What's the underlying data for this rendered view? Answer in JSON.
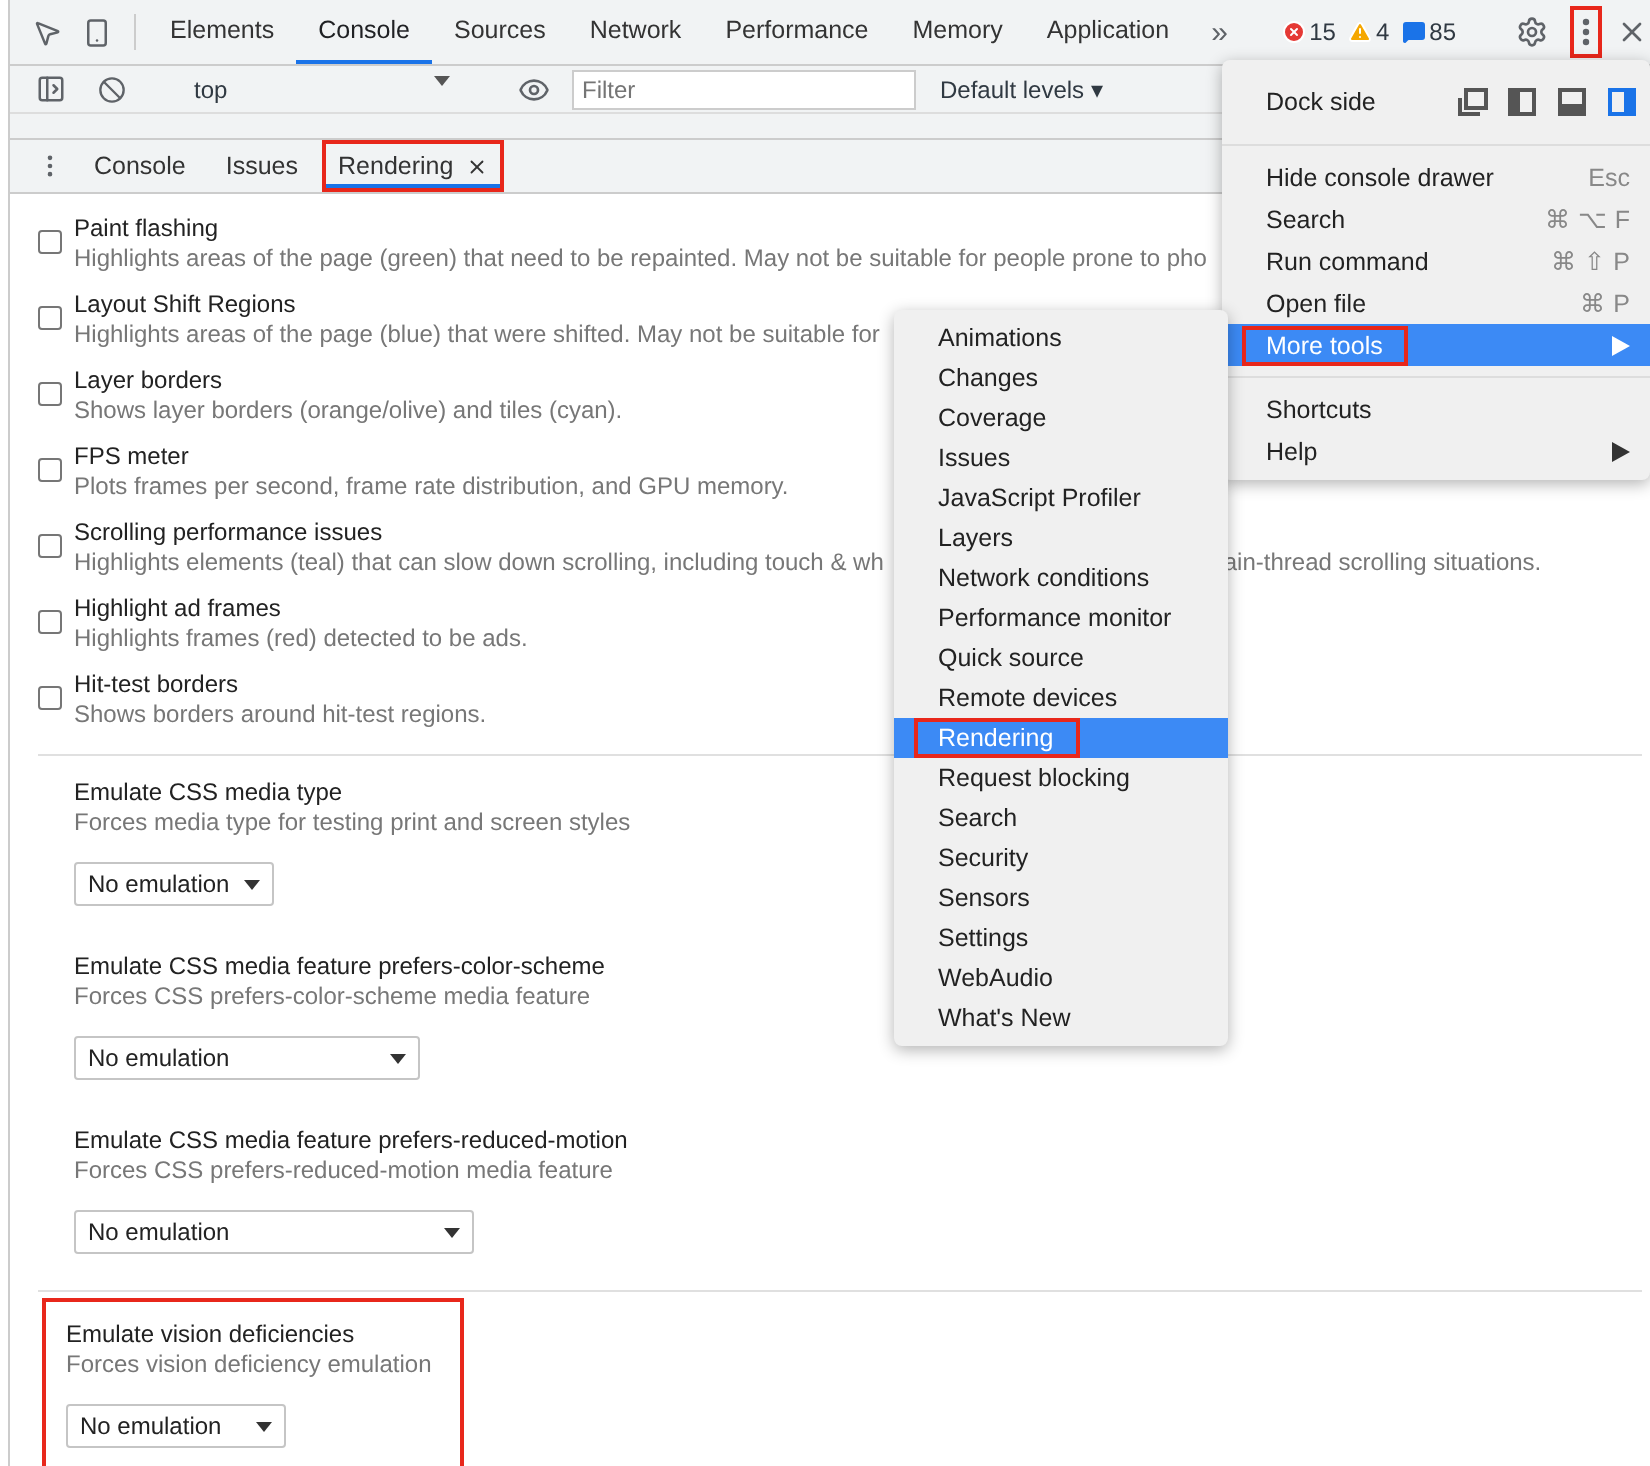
{
  "toolbar": {
    "tabs": [
      {
        "label": "Elements",
        "selected": false
      },
      {
        "label": "Console",
        "selected": true
      },
      {
        "label": "Sources",
        "selected": false
      },
      {
        "label": "Network",
        "selected": false
      },
      {
        "label": "Performance",
        "selected": false
      },
      {
        "label": "Memory",
        "selected": false
      },
      {
        "label": "Application",
        "selected": false
      }
    ],
    "overflow": "»",
    "errors": "15",
    "warnings": "4",
    "messages": "85",
    "menu_button_highlighted": true
  },
  "console_bar": {
    "context": "top",
    "filter_placeholder": "Filter",
    "levels": "Default levels ▾"
  },
  "drawer_tabs": [
    {
      "label": "Console",
      "selected": false,
      "closable": false,
      "highlighted": false
    },
    {
      "label": "Issues",
      "selected": false,
      "closable": false,
      "highlighted": false
    },
    {
      "label": "Rendering",
      "selected": true,
      "closable": true,
      "highlighted": true
    }
  ],
  "options": [
    {
      "title": "Paint flashing",
      "description": [
        "Highlights areas of the page (green) that need to be repainted. May not be suitable for people prone to pho"
      ],
      "checked": false
    },
    {
      "title": "Layout Shift Regions",
      "description": [
        "Highlights areas of the page (blue) that were shifted. May not be suitable for"
      ],
      "checked": false
    },
    {
      "title": "Layer borders",
      "description": [
        "Shows layer borders (orange/olive) and tiles (cyan)."
      ],
      "checked": false
    },
    {
      "title": "FPS meter",
      "description": [
        "Plots frames per second, frame rate distribution, and GPU memory."
      ],
      "checked": false
    },
    {
      "title": "Scrolling performance issues",
      "description": [
        "Highlights elements (teal) that can slow down scrolling, including touch & wh",
        "ain-thread scrolling situations."
      ],
      "checked": false
    },
    {
      "title": "Highlight ad frames",
      "description": [
        "Highlights frames (red) detected to be ads."
      ],
      "checked": false
    },
    {
      "title": "Hit-test borders",
      "description": [
        "Shows borders around hit-test regions."
      ],
      "checked": false
    }
  ],
  "emulation_groups": [
    [
      {
        "title": "Emulate CSS media type",
        "description": "Forces media type for testing print and screen styles",
        "value": "No emulation",
        "highlighted": false
      },
      {
        "title": "Emulate CSS media feature prefers-color-scheme",
        "description": "Forces CSS prefers-color-scheme media feature",
        "value": "No emulation",
        "highlighted": false
      },
      {
        "title": "Emulate CSS media feature prefers-reduced-motion",
        "description": "Forces CSS prefers-reduced-motion media feature",
        "value": "No emulation",
        "highlighted": false
      }
    ],
    [
      {
        "title": "Emulate vision deficiencies",
        "description": "Forces vision deficiency emulation",
        "value": "No emulation",
        "highlighted": true
      }
    ]
  ],
  "main_menu": {
    "dock_label": "Dock side",
    "dock_options": [
      {
        "kind": "undock",
        "selected": false
      },
      {
        "kind": "left",
        "selected": false
      },
      {
        "kind": "bottom",
        "selected": false
      },
      {
        "kind": "right",
        "selected": true
      }
    ],
    "groups": [
      [
        {
          "label": "Hide console drawer",
          "shortcut": "Esc",
          "submenu": false,
          "selected": false,
          "highlighted": false
        },
        {
          "label": "Search",
          "shortcut": "⌘ ⌥ F",
          "submenu": false,
          "selected": false,
          "highlighted": false
        },
        {
          "label": "Run command",
          "shortcut": "⌘ ⇧ P",
          "submenu": false,
          "selected": false,
          "highlighted": false
        },
        {
          "label": "Open file",
          "shortcut": "⌘ P",
          "submenu": false,
          "selected": false,
          "highlighted": false
        },
        {
          "label": "More tools",
          "submenu": true,
          "selected": true,
          "highlighted": true
        }
      ],
      [
        {
          "label": "Shortcuts",
          "submenu": false,
          "selected": false,
          "highlighted": false
        },
        {
          "label": "Help",
          "submenu": true,
          "selected": false,
          "highlighted": false
        }
      ]
    ]
  },
  "submenu": [
    {
      "label": "Animations",
      "selected": false,
      "highlighted": false
    },
    {
      "label": "Changes",
      "selected": false,
      "highlighted": false
    },
    {
      "label": "Coverage",
      "selected": false,
      "highlighted": false
    },
    {
      "label": "Issues",
      "selected": false,
      "highlighted": false
    },
    {
      "label": "JavaScript Profiler",
      "selected": false,
      "highlighted": false
    },
    {
      "label": "Layers",
      "selected": false,
      "highlighted": false
    },
    {
      "label": "Network conditions",
      "selected": false,
      "highlighted": false
    },
    {
      "label": "Performance monitor",
      "selected": false,
      "highlighted": false
    },
    {
      "label": "Quick source",
      "selected": false,
      "highlighted": false
    },
    {
      "label": "Remote devices",
      "selected": false,
      "highlighted": false
    },
    {
      "label": "Rendering",
      "selected": true,
      "highlighted": true
    },
    {
      "label": "Request blocking",
      "selected": false,
      "highlighted": false
    },
    {
      "label": "Search",
      "selected": false,
      "highlighted": false
    },
    {
      "label": "Security",
      "selected": false,
      "highlighted": false
    },
    {
      "label": "Sensors",
      "selected": false,
      "highlighted": false
    },
    {
      "label": "Settings",
      "selected": false,
      "highlighted": false
    },
    {
      "label": "WebAudio",
      "selected": false,
      "highlighted": false
    },
    {
      "label": "What's New",
      "selected": false,
      "highlighted": false
    }
  ]
}
